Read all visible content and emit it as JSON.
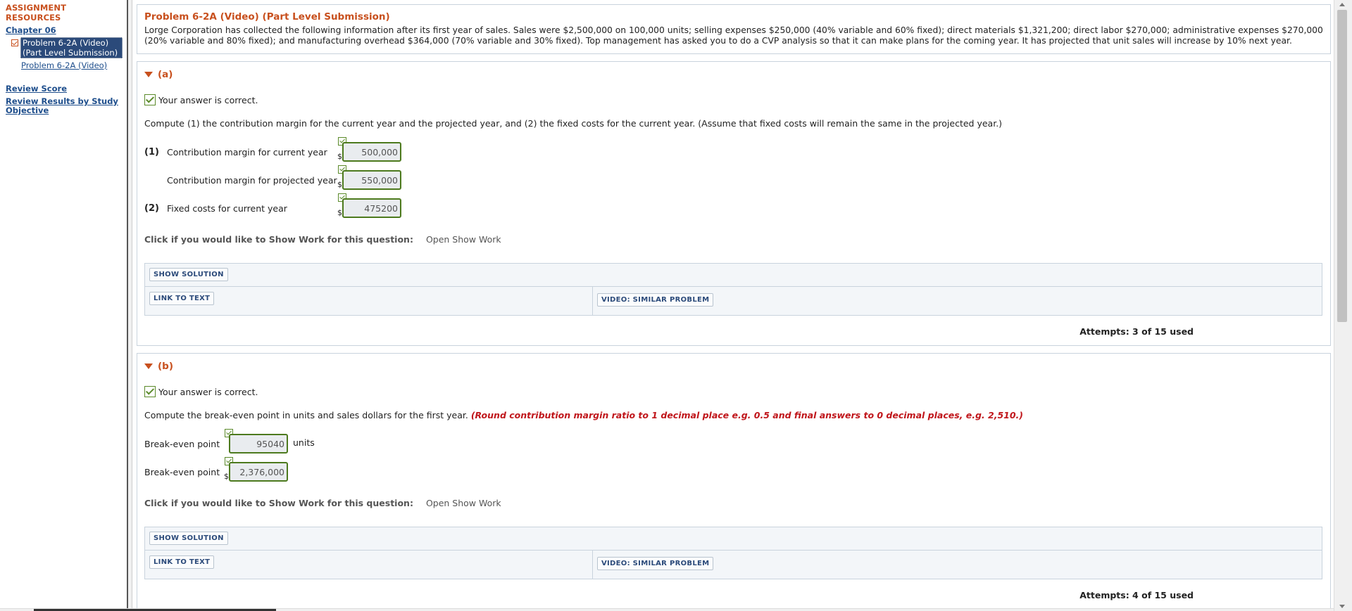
{
  "sidebar": {
    "title": "ASSIGNMENT RESOURCES",
    "chapter": "Chapter 06",
    "current_item": "Problem 6-2A (Video) (Part Level Submission)",
    "sub_item": "Problem 6-2A (Video)",
    "review_score": "Review Score",
    "review_results": "Review Results by Study Objective"
  },
  "problem": {
    "title": "Problem 6-2A (Video) (Part Level Submission)",
    "text": "Lorge Corporation has collected the following information after its first year of sales. Sales were $2,500,000 on 100,000 units; selling expenses $250,000 (40% variable and 60% fixed); direct materials $1,321,200; direct labor $270,000; administrative expenses $270,000 (20% variable and 80% fixed); and manufacturing overhead $364,000 (70% variable and 30% fixed). Top management has asked you to do a CVP analysis so that it can make plans for the coming year. It has projected that unit sales will increase by 10% next year."
  },
  "common": {
    "correct": "Your answer is correct.",
    "show_work_prompt": "Click if you would like to Show Work for this question:",
    "open_show_work": "Open Show Work",
    "show_solution": "SHOW SOLUTION",
    "link_to_text": "LINK TO TEXT",
    "video_similar": "VIDEO: SIMILAR PROBLEM",
    "dollar": "$"
  },
  "part_a": {
    "label": "(a)",
    "instruction": "Compute (1) the contribution margin for the current year and the projected year, and (2) the fixed costs for the current year. (Assume that fixed costs will remain the same in the projected year.)",
    "rows": [
      {
        "num": "(1)",
        "label": "Contribution margin for current year",
        "value": "500,000"
      },
      {
        "num": "",
        "label": "Contribution margin for projected year",
        "value": "550,000"
      },
      {
        "num": "(2)",
        "label": "Fixed costs for current year",
        "value": "475200"
      }
    ],
    "attempts": "Attempts: 3 of 15 used"
  },
  "part_b": {
    "label": "(b)",
    "instruction": "Compute the break-even point in units and sales dollars for the first year.",
    "instruction_red": "(Round contribution margin ratio to 1 decimal place e.g. 0.5 and final answers to 0 decimal places, e.g. 2,510.)",
    "rows": [
      {
        "label": "Break-even point",
        "value": "95040",
        "unit": "units"
      },
      {
        "label": "Break-even point",
        "value": "2,376,000"
      }
    ],
    "attempts": "Attempts: 4 of 15 used"
  }
}
